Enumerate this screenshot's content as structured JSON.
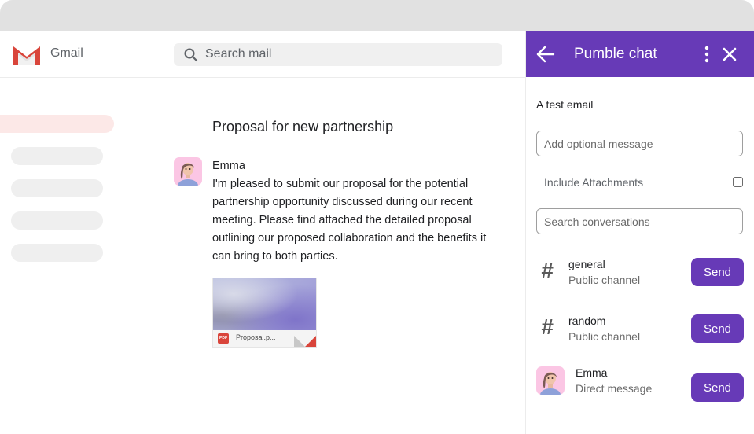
{
  "gmail": {
    "app_name": "Gmail",
    "search_placeholder": "Search mail",
    "email": {
      "subject": "Proposal for new partnership",
      "sender": "Emma",
      "body": "I'm pleased to submit our proposal for the potential partnership opportunity discussed during our recent meeting. Please find attached the detailed proposal outlining our proposed collaboration and the benefits it can bring to both parties.",
      "attachment": {
        "type_badge": "PDF",
        "name": "Proposal.p..."
      }
    },
    "colors": {
      "logo_red": "#d9453b",
      "active_item": "#fce8e7"
    }
  },
  "pumble": {
    "title": "Pumble chat",
    "email_title": "A test email",
    "message_placeholder": "Add optional message",
    "include_attachments_label": "Include Attachments",
    "include_attachments_checked": false,
    "search_placeholder": "Search conversations",
    "conversations": [
      {
        "name": "general",
        "type": "Public channel",
        "icon": "hash-icon",
        "button": "Send"
      },
      {
        "name": "random",
        "type": "Public channel",
        "icon": "hash-icon",
        "button": "Send"
      },
      {
        "name": "Emma",
        "type": "Direct message",
        "icon": "avatar",
        "button": "Send"
      }
    ],
    "colors": {
      "accent": "#673ab7"
    }
  }
}
